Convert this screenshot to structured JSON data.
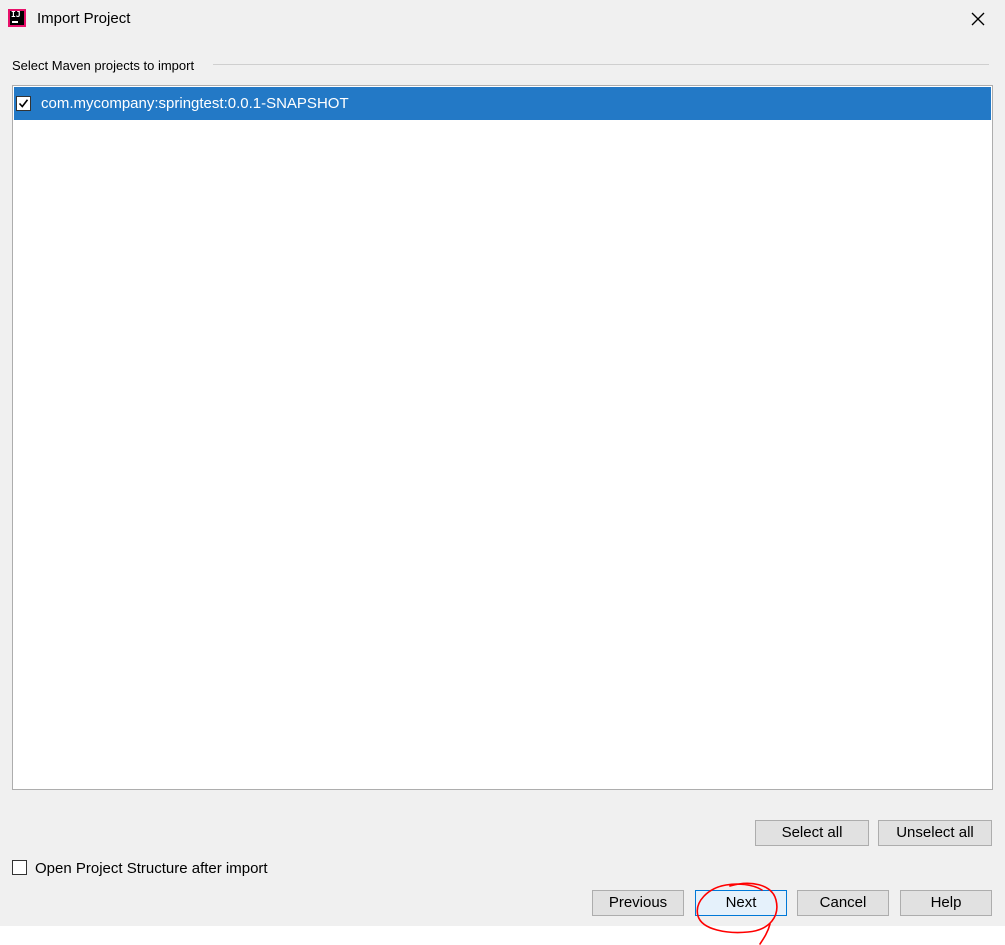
{
  "window": {
    "title": "Import Project",
    "app_icon": "intellij-idea-icon",
    "app_icon_text": "IJ",
    "close_icon": "close-icon"
  },
  "section": {
    "label": "Select Maven projects to import"
  },
  "projects": [
    {
      "label": "com.mycompany:springtest:0.0.1-SNAPSHOT",
      "checked": true,
      "selected": true
    }
  ],
  "list_buttons": {
    "select_all": "Select all",
    "unselect_all": "Unselect all"
  },
  "options": {
    "open_structure_label": "Open Project Structure after import",
    "open_structure_checked": false
  },
  "footer_buttons": {
    "previous": "Previous",
    "next": "Next",
    "cancel": "Cancel",
    "help": "Help"
  },
  "colors": {
    "selection": "#2379c6",
    "annotation": "#ff0000",
    "default_button_border": "#0078d7"
  }
}
